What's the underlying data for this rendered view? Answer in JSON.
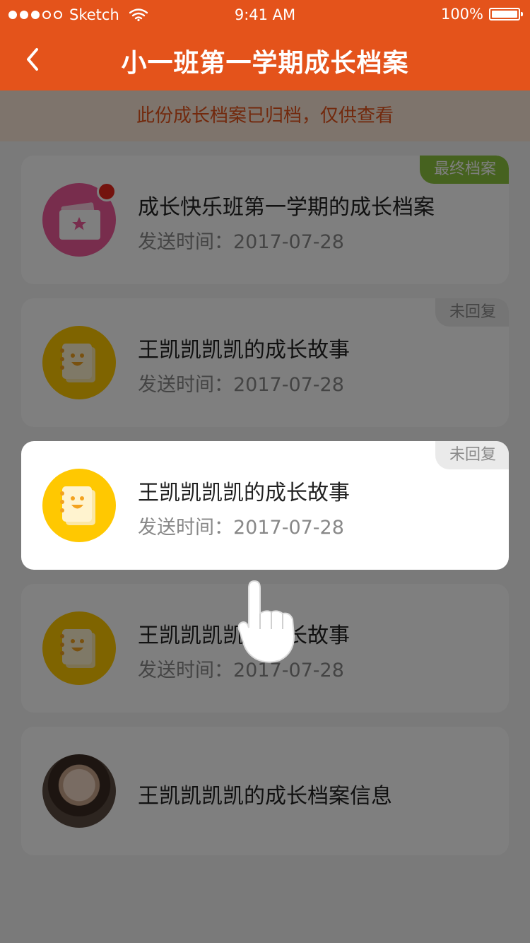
{
  "status_bar": {
    "carrier": "Sketch",
    "time": "9:41 AM",
    "battery": "100%"
  },
  "nav": {
    "title": "小一班第一学期成长档案",
    "back_icon": "chevron-left-icon"
  },
  "notice": "此份成长档案已归档，仅供查看",
  "cards": [
    {
      "title": "成长快乐班第一学期的成长档案",
      "date_label": "发送时间：",
      "date": "2017-07-28",
      "tag": "最终档案",
      "icon": "folder-star-icon",
      "has_red_dot": true
    },
    {
      "title": "王凯凯凯凯的成长故事",
      "date_label": "发送时间：",
      "date": "2017-07-28",
      "tag": "未回复",
      "icon": "notebook-smile-icon"
    },
    {
      "title": "王凯凯凯凯的成长故事",
      "date_label": "发送时间：",
      "date": "2017-07-28",
      "tag": "未回复",
      "icon": "notebook-smile-icon",
      "highlighted": true
    },
    {
      "title": "王凯凯凯凯的成长故事",
      "date_label": "发送时间：",
      "date": "2017-07-28",
      "icon": "notebook-smile-icon"
    },
    {
      "title": "王凯凯凯凯的成长档案信息",
      "icon": "child-avatar"
    }
  ],
  "colors": {
    "accent": "#e4531b",
    "notice_bg": "#fde9d8",
    "final_tag": "#8cc43f",
    "unreplied_tag": "#eaeaea",
    "pink_icon": "#f05a9b",
    "yellow_icon": "#ffc801",
    "overlay": "rgba(0,0,0,0.5)"
  },
  "gesture": "tap-hand-icon"
}
